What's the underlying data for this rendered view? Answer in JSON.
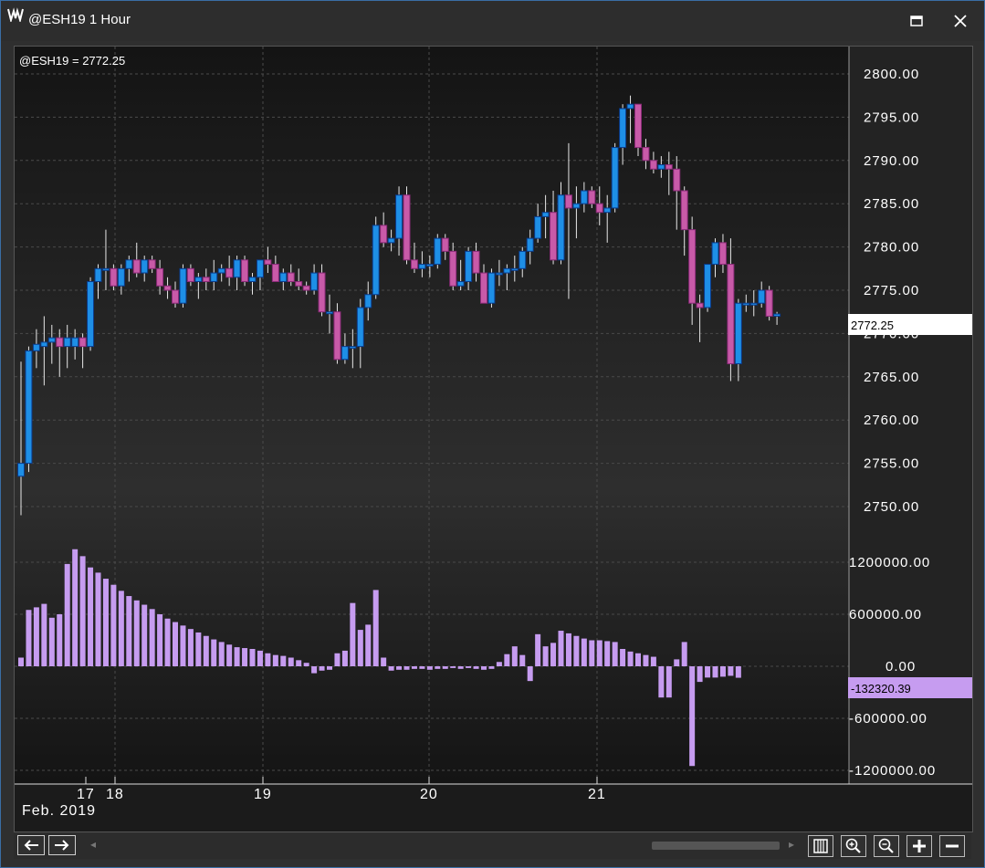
{
  "window": {
    "title": "@ESH19 1 Hour",
    "maximize_icon": "maximize-icon",
    "close_icon": "close-icon"
  },
  "chart": {
    "price_readout": "@ESH19 = 2772.25",
    "last_price_label": "2772.25",
    "volume_last_label": "-132320.39",
    "colors": {
      "up_candle": "#1e8fe6",
      "down_candle": "#c85aa8",
      "volume_bar": "#c69cf0",
      "price_marker_bg": "#ffffff",
      "volume_marker_bg": "#c69cf0"
    },
    "date_labels": [
      "17",
      "18",
      "19",
      "20",
      "21"
    ],
    "date_caption": "Feb. 2019"
  },
  "chart_data": [
    {
      "type": "candlestick",
      "title": "@ESH19 1 Hour",
      "y_ticks": [
        "2800.00",
        "2795.00",
        "2790.00",
        "2785.00",
        "2780.00",
        "2775.00",
        "2770.00",
        "2765.00",
        "2760.00",
        "2755.00",
        "2750.00"
      ],
      "ylim": [
        2747,
        2802
      ],
      "grid": true,
      "series": [
        {
          "name": "@ESH19",
          "candles": [
            [
              2753.5,
              2766.75,
              2749.0,
              2755.0
            ],
            [
              2755.0,
              2768.5,
              2754.0,
              2768.0
            ],
            [
              2768.0,
              2770.5,
              2766.0,
              2768.75
            ],
            [
              2768.5,
              2772.0,
              2764.0,
              2769.0
            ],
            [
              2769.0,
              2771.0,
              2766.5,
              2769.5
            ],
            [
              2769.5,
              2770.5,
              2765.0,
              2768.5
            ],
            [
              2768.5,
              2771.0,
              2766.0,
              2769.5
            ],
            [
              2768.5,
              2770.5,
              2767.0,
              2769.5
            ],
            [
              2769.5,
              2770.0,
              2766.0,
              2768.5
            ],
            [
              2768.5,
              2776.5,
              2768.0,
              2776.0
            ],
            [
              2776.0,
              2778.0,
              2774.0,
              2777.5
            ],
            [
              2777.5,
              2782.0,
              2775.0,
              2777.5
            ],
            [
              2777.5,
              2778.0,
              2775.0,
              2775.5
            ],
            [
              2775.5,
              2778.0,
              2774.5,
              2777.5
            ],
            [
              2777.5,
              2779.0,
              2776.0,
              2778.5
            ],
            [
              2778.5,
              2780.5,
              2776.5,
              2777.0
            ],
            [
              2777.0,
              2779.0,
              2776.0,
              2778.5
            ],
            [
              2778.5,
              2779.0,
              2777.0,
              2777.5
            ],
            [
              2777.5,
              2778.5,
              2774.5,
              2775.5
            ],
            [
              2775.5,
              2776.5,
              2774.0,
              2775.0
            ],
            [
              2775.0,
              2776.0,
              2773.0,
              2773.5
            ],
            [
              2773.5,
              2778.0,
              2773.0,
              2777.5
            ],
            [
              2777.5,
              2778.0,
              2775.5,
              2776.0
            ],
            [
              2776.0,
              2777.0,
              2774.0,
              2776.5
            ],
            [
              2776.5,
              2777.5,
              2775.0,
              2776.0
            ],
            [
              2776.0,
              2778.5,
              2775.0,
              2777.0
            ],
            [
              2777.0,
              2778.0,
              2776.0,
              2777.5
            ],
            [
              2777.5,
              2779.0,
              2775.5,
              2776.5
            ],
            [
              2776.5,
              2779.0,
              2775.0,
              2778.5
            ],
            [
              2778.5,
              2779.0,
              2775.5,
              2776.0
            ],
            [
              2776.0,
              2777.0,
              2774.5,
              2776.5
            ],
            [
              2776.5,
              2778.0,
              2775.0,
              2778.5
            ],
            [
              2778.5,
              2780.0,
              2777.0,
              2778.0
            ],
            [
              2778.0,
              2779.0,
              2776.5,
              2776.0
            ],
            [
              2776.0,
              2777.5,
              2775.0,
              2777.0
            ],
            [
              2777.0,
              2778.0,
              2775.5,
              2776.0
            ],
            [
              2776.0,
              2777.5,
              2775.0,
              2775.5
            ],
            [
              2775.5,
              2776.0,
              2774.5,
              2775.0
            ],
            [
              2775.0,
              2778.0,
              2774.5,
              2777.0
            ],
            [
              2777.0,
              2778.0,
              2772.0,
              2772.5
            ],
            [
              2772.5,
              2774.5,
              2770.0,
              2772.5
            ],
            [
              2772.5,
              2773.5,
              2766.5,
              2767.0
            ],
            [
              2767.0,
              2770.0,
              2766.5,
              2768.5
            ],
            [
              2768.5,
              2770.5,
              2766.0,
              2768.5
            ],
            [
              2768.5,
              2774.0,
              2766.0,
              2773.0
            ],
            [
              2773.0,
              2776.0,
              2771.5,
              2774.5
            ],
            [
              2774.5,
              2783.5,
              2774.0,
              2782.5
            ],
            [
              2782.5,
              2784.0,
              2780.0,
              2780.5
            ],
            [
              2780.5,
              2782.0,
              2779.5,
              2781.0
            ],
            [
              2781.0,
              2787.0,
              2779.0,
              2786.0
            ],
            [
              2786.0,
              2787.0,
              2778.0,
              2778.5
            ],
            [
              2778.5,
              2780.5,
              2777.0,
              2777.5
            ],
            [
              2777.5,
              2779.5,
              2776.5,
              2778.0
            ],
            [
              2778.0,
              2779.0,
              2776.5,
              2778.0
            ],
            [
              2778.0,
              2781.5,
              2777.5,
              2781.0
            ],
            [
              2781.0,
              2781.5,
              2778.5,
              2779.5
            ],
            [
              2779.5,
              2780.5,
              2775.0,
              2775.5
            ],
            [
              2775.5,
              2778.5,
              2775.0,
              2776.0
            ],
            [
              2776.0,
              2780.0,
              2775.0,
              2779.5
            ],
            [
              2779.5,
              2780.5,
              2776.0,
              2777.0
            ],
            [
              2777.0,
              2778.0,
              2773.5,
              2773.5
            ],
            [
              2773.5,
              2777.5,
              2773.0,
              2777.0
            ],
            [
              2777.0,
              2778.5,
              2775.5,
              2777.0
            ],
            [
              2777.0,
              2778.0,
              2775.0,
              2777.5
            ],
            [
              2777.5,
              2779.0,
              2776.0,
              2777.5
            ],
            [
              2777.5,
              2780.0,
              2776.5,
              2779.5
            ],
            [
              2779.5,
              2782.0,
              2778.0,
              2781.0
            ],
            [
              2781.0,
              2785.0,
              2780.5,
              2783.5
            ],
            [
              2783.5,
              2786.0,
              2781.0,
              2784.0
            ],
            [
              2784.0,
              2786.5,
              2778.0,
              2778.5
            ],
            [
              2778.5,
              2787.5,
              2778.0,
              2786.0
            ],
            [
              2786.0,
              2792.0,
              2774.0,
              2784.5
            ],
            [
              2784.5,
              2787.0,
              2781.0,
              2785.0
            ],
            [
              2785.0,
              2787.5,
              2784.0,
              2786.5
            ],
            [
              2786.5,
              2787.0,
              2784.5,
              2785.0
            ],
            [
              2785.0,
              2787.0,
              2782.5,
              2784.0
            ],
            [
              2784.0,
              2786.0,
              2780.5,
              2784.5
            ],
            [
              2784.5,
              2792.0,
              2784.0,
              2791.5
            ],
            [
              2791.5,
              2796.5,
              2789.5,
              2796.0
            ],
            [
              2796.0,
              2797.5,
              2792.0,
              2796.5
            ],
            [
              2796.5,
              2796.5,
              2790.5,
              2791.5
            ],
            [
              2791.5,
              2792.5,
              2789.0,
              2790.0
            ],
            [
              2790.0,
              2791.0,
              2788.5,
              2789.0
            ],
            [
              2789.0,
              2790.5,
              2788.0,
              2789.5
            ],
            [
              2789.5,
              2791.0,
              2786.0,
              2789.0
            ],
            [
              2789.0,
              2790.5,
              2782.0,
              2786.5
            ],
            [
              2786.5,
              2787.0,
              2779.0,
              2782.0
            ],
            [
              2782.0,
              2783.5,
              2771.0,
              2773.5
            ],
            [
              2773.5,
              2774.5,
              2769.0,
              2773.0
            ],
            [
              2773.0,
              2776.5,
              2772.5,
              2778.0
            ],
            [
              2778.0,
              2781.0,
              2776.5,
              2780.5
            ],
            [
              2780.5,
              2781.5,
              2777.0,
              2778.0
            ],
            [
              2778.0,
              2781.0,
              2764.5,
              2766.5
            ],
            [
              2766.5,
              2774.0,
              2764.5,
              2773.5
            ],
            [
              2773.5,
              2774.5,
              2772.5,
              2773.5
            ],
            [
              2773.5,
              2775.0,
              2772.0,
              2773.5
            ],
            [
              2773.5,
              2776.0,
              2773.0,
              2775.0
            ],
            [
              2775.0,
              2775.5,
              2771.5,
              2772.0
            ],
            [
              2772.0,
              2772.5,
              2771.0,
              2772.25
            ]
          ]
        }
      ],
      "candle_format": "[open, high, low, close]"
    },
    {
      "type": "bar",
      "y_ticks": [
        "1200000.00",
        "600000.00",
        "0.00",
        "-600000.00",
        "-1200000.00"
      ],
      "ylim": [
        -1350000,
        1350000
      ],
      "grid": true,
      "series": [
        {
          "name": "@ESH19",
          "values": [
            100000,
            650000,
            680000,
            720000,
            560000,
            600000,
            1180000,
            1350000,
            1270000,
            1140000,
            1080000,
            1010000,
            940000,
            870000,
            810000,
            760000,
            710000,
            660000,
            600000,
            550000,
            510000,
            470000,
            430000,
            390000,
            350000,
            310000,
            280000,
            250000,
            220000,
            210000,
            200000,
            180000,
            150000,
            130000,
            120000,
            100000,
            70000,
            40000,
            -80000,
            -50000,
            -40000,
            150000,
            180000,
            730000,
            420000,
            480000,
            880000,
            100000,
            -50000,
            -40000,
            -40000,
            -30000,
            -30000,
            -40000,
            -30000,
            -30000,
            -20000,
            -30000,
            -20000,
            -30000,
            -40000,
            -30000,
            50000,
            140000,
            230000,
            130000,
            -170000,
            370000,
            230000,
            270000,
            410000,
            380000,
            350000,
            320000,
            300000,
            300000,
            290000,
            280000,
            200000,
            170000,
            150000,
            130000,
            110000,
            -360000,
            -360000,
            80000,
            280000,
            -1150000,
            -180000,
            -130000,
            -130000,
            -120000,
            -110000,
            -132320.39
          ]
        }
      ]
    }
  ],
  "bottombar": {
    "left_arrow_icon": "arrow-left-icon",
    "right_arrow_icon": "arrow-right-icon",
    "tools": [
      "bar-spacing-icon",
      "zoom-in-icon",
      "zoom-out-icon",
      "plus-icon",
      "minus-icon"
    ],
    "tool_glyphs": [
      "▥",
      "+",
      "−",
      "+",
      "−"
    ]
  }
}
